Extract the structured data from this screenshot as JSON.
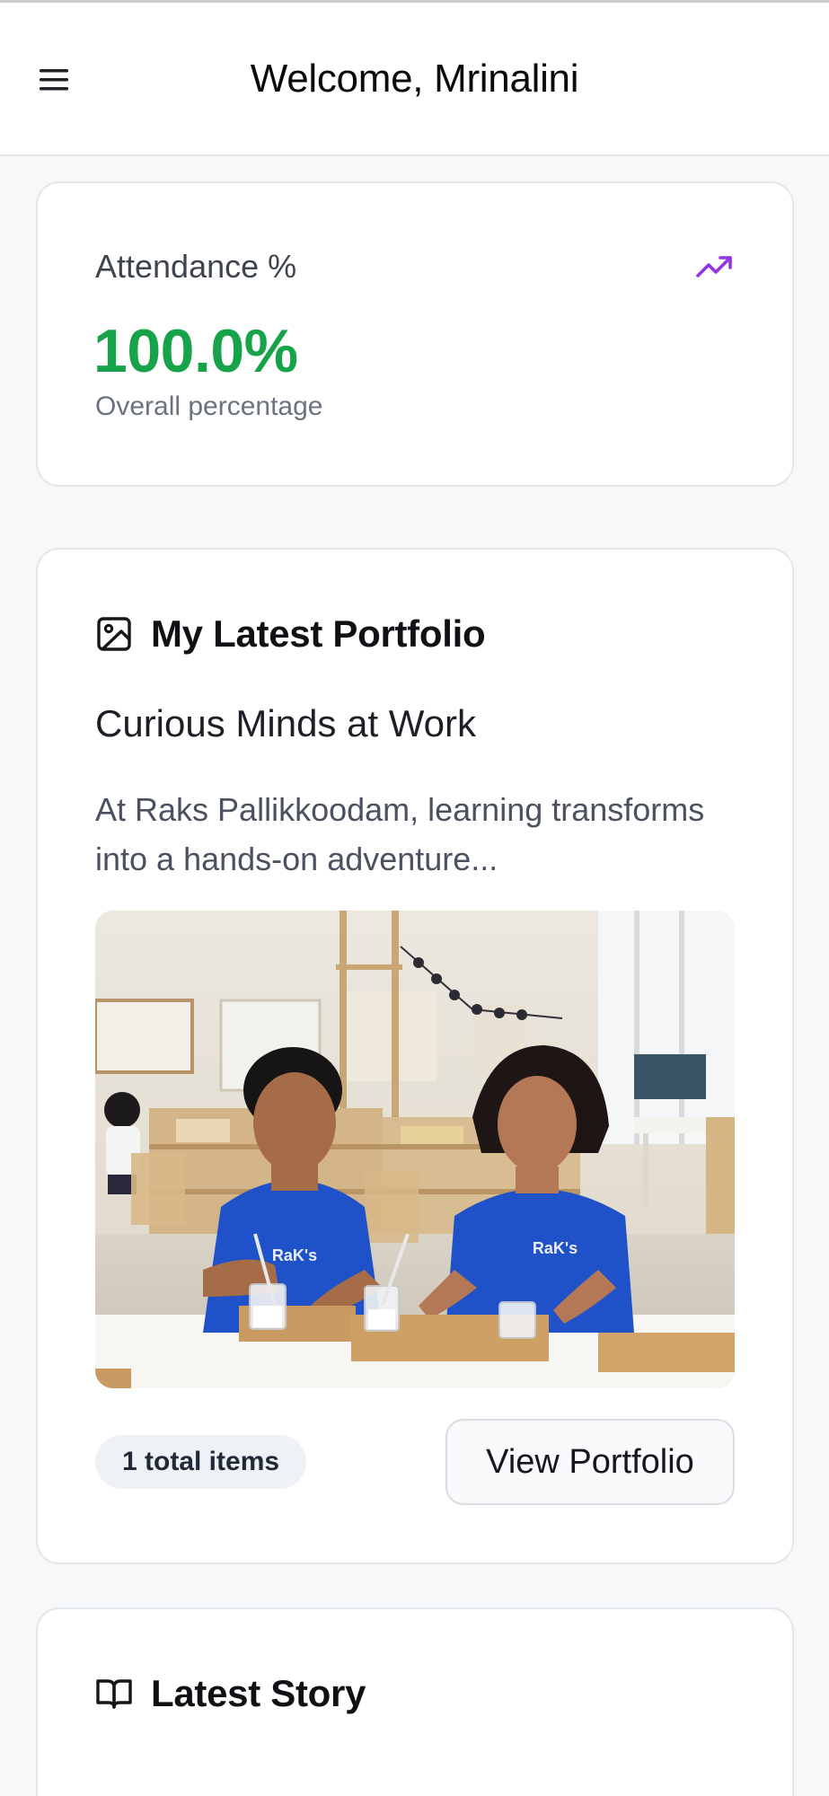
{
  "header": {
    "title": "Welcome, Mrinalini",
    "menu_icon": "hamburger-menu-icon"
  },
  "attendance": {
    "label": "Attendance %",
    "value": "100.0%",
    "value_fraction": 1.0,
    "subtitle": "Overall percentage",
    "icon": "trending-up-icon",
    "value_color": "#16a34a",
    "icon_color": "#9333ea"
  },
  "portfolio": {
    "heading": "My Latest Portfolio",
    "heading_icon": "image-icon",
    "title": "Curious Minds at Work",
    "description": "At Raks Pallikkoodam, learning transforms into a hands-on adventure...",
    "photo_shirt_text": "RaK's",
    "items_badge": "1 total items",
    "view_button": "View Portfolio"
  },
  "story": {
    "heading": "Latest Story",
    "heading_icon": "book-open-icon"
  }
}
